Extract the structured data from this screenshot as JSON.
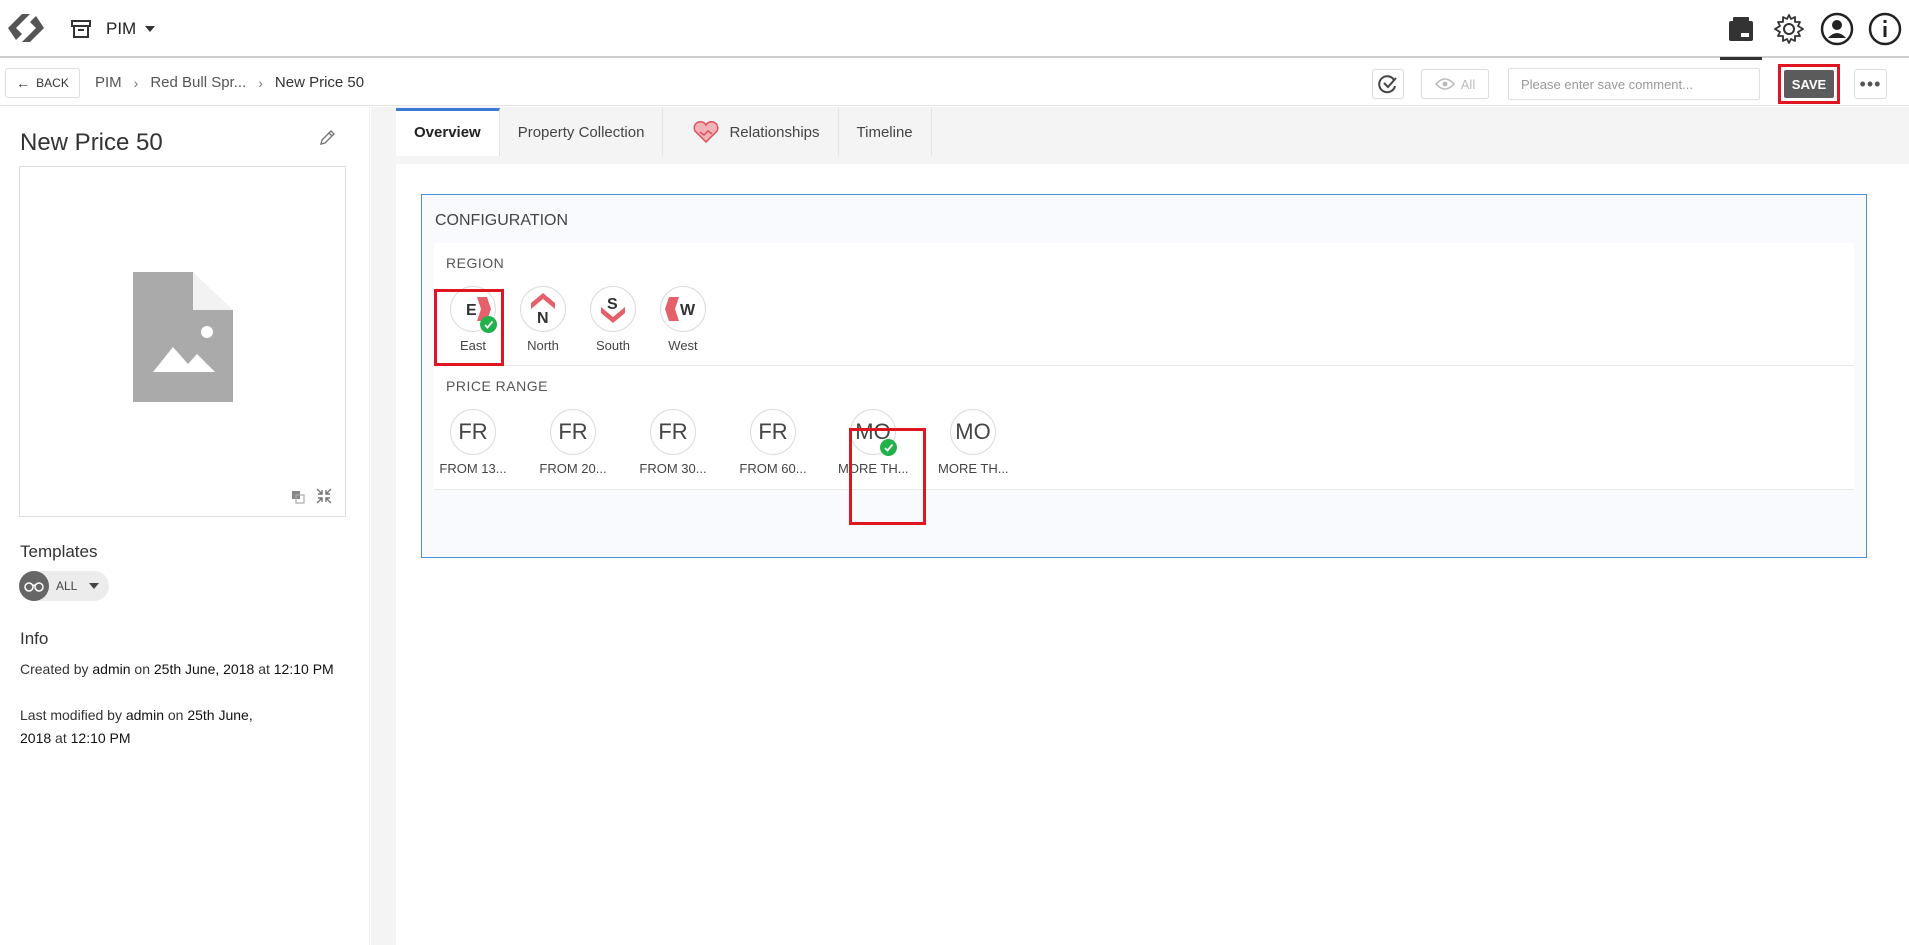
{
  "topbar": {
    "module_label": "PIM",
    "icons": [
      "content-icon",
      "settings-icon",
      "user-icon",
      "info-icon"
    ]
  },
  "actionbar": {
    "back_label": "BACK",
    "breadcrumb": [
      "PIM",
      "Red Bull Spr...",
      "New Price 50"
    ],
    "view_label": "All",
    "comment_placeholder": "Please enter save comment...",
    "save_label": "SAVE",
    "more_label": "•••"
  },
  "entity": {
    "title": "New Price 50"
  },
  "templates": {
    "heading": "Templates",
    "selected": "ALL"
  },
  "info": {
    "heading": "Info",
    "created_prefix": "Created by",
    "created_user": "admin",
    "created_on": "on",
    "created_date": "25th June, 2018",
    "created_at": "at",
    "created_time": "12:10 PM",
    "modified_prefix": "Last modified by",
    "modified_user": "admin",
    "modified_on": "on",
    "modified_date_1": "25th June,",
    "modified_date_2": "2018",
    "modified_at": "at",
    "modified_time": "12:10 PM"
  },
  "tabs": [
    {
      "label": "Overview",
      "active": true
    },
    {
      "label": "Property Collection",
      "active": false
    },
    {
      "label": "Relationships",
      "active": false
    },
    {
      "label": "Timeline",
      "active": false
    }
  ],
  "configuration": {
    "title": "CONFIGURATION",
    "region": {
      "title": "REGION",
      "items": [
        {
          "letter": "E",
          "label": "East",
          "selected": true
        },
        {
          "letter": "N",
          "label": "North",
          "selected": false
        },
        {
          "letter": "S",
          "label": "South",
          "selected": false
        },
        {
          "letter": "W",
          "label": "West",
          "selected": false
        }
      ]
    },
    "price_range": {
      "title": "PRICE RANGE",
      "items": [
        {
          "abbr": "FR",
          "label": "FROM 13...",
          "selected": false
        },
        {
          "abbr": "FR",
          "label": "FROM 20...",
          "selected": false
        },
        {
          "abbr": "FR",
          "label": "FROM 30...",
          "selected": false
        },
        {
          "abbr": "FR",
          "label": "FROM 60...",
          "selected": false
        },
        {
          "abbr": "MO",
          "label": "MORE TH...",
          "selected": true
        },
        {
          "abbr": "MO",
          "label": "MORE TH...",
          "selected": false
        }
      ]
    }
  },
  "colors": {
    "accent_blue": "#3a7bd5",
    "highlight_red": "#e01522",
    "success_green": "#22b24c",
    "save_bg": "#5b5b5b"
  }
}
